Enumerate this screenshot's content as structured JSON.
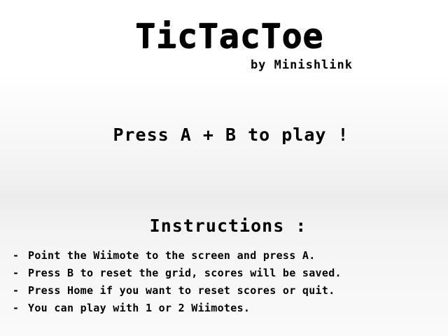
{
  "game": {
    "title": "TicTacToe",
    "author": "by Minishlink"
  },
  "prompt": {
    "start": "Press A + B to play !"
  },
  "instructions": {
    "heading": "Instructions :",
    "bullet": "-",
    "items": [
      "Point the Wiimote to the screen and press A.",
      "Press B to reset the grid, scores will be saved.",
      "Press Home if you want to reset scores or quit.",
      "You can play with 1 or 2 Wiimotes."
    ]
  },
  "colors": {
    "text": "#000000",
    "background": "#ffffff"
  }
}
